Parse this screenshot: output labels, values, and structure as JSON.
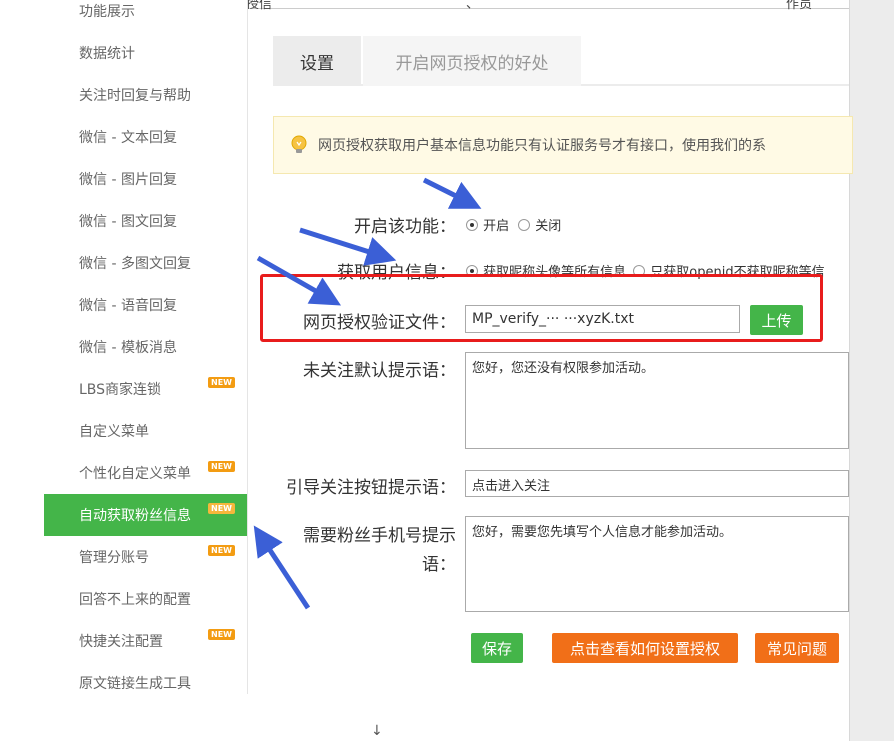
{
  "sidebar": {
    "items": [
      {
        "label": "功能展示",
        "new": false,
        "active": false
      },
      {
        "label": "数据统计",
        "new": false,
        "active": false
      },
      {
        "label": "关注时回复与帮助",
        "new": false,
        "active": false
      },
      {
        "label": "微信 - 文本回复",
        "new": false,
        "active": false
      },
      {
        "label": "微信 - 图片回复",
        "new": false,
        "active": false
      },
      {
        "label": "微信 - 图文回复",
        "new": false,
        "active": false
      },
      {
        "label": "微信 - 多图文回复",
        "new": false,
        "active": false
      },
      {
        "label": "微信 - 语音回复",
        "new": false,
        "active": false
      },
      {
        "label": "微信 - 模板消息",
        "new": false,
        "active": false
      },
      {
        "label": "LBS商家连锁",
        "new": true,
        "active": false
      },
      {
        "label": "自定义菜单",
        "new": false,
        "active": false
      },
      {
        "label": "个性化自定义菜单",
        "new": true,
        "active": false
      },
      {
        "label": "自动获取粉丝信息",
        "new": true,
        "active": true
      },
      {
        "label": "管理分账号",
        "new": true,
        "active": false
      },
      {
        "label": "回答不上来的配置",
        "new": false,
        "active": false
      },
      {
        "label": "快捷关注配置",
        "new": true,
        "active": false
      },
      {
        "label": "原文链接生成工具",
        "new": false,
        "active": false
      }
    ],
    "new_badge": "NEW",
    "active_color": "#44b549"
  },
  "tabs": [
    {
      "label": "设置",
      "active": true
    },
    {
      "label": "开启网页授权的好处",
      "active": false
    }
  ],
  "notice": {
    "text": "网页授权获取用户基本信息功能只有认证服务号才有接口，使用我们的系",
    "icon": "lightbulb-icon"
  },
  "form": {
    "enable": {
      "label": "开启该功能：",
      "options": [
        "开启",
        "关闭"
      ],
      "selected": "开启"
    },
    "userinfo": {
      "label": "获取用户信息：",
      "options": [
        "获取昵称头像等所有信息",
        "只获取openid不获取昵称等信"
      ],
      "selected": "获取昵称头像等所有信息"
    },
    "verify_file": {
      "label": "网页授权验证文件：",
      "value": "MP_verify_··· ···xyzK.txt",
      "upload_label": "上传"
    },
    "unfollowed_tip": {
      "label": "未关注默认提示语：",
      "value": "您好，您还没有权限参加活动。"
    },
    "follow_button_tip": {
      "label": "引导关注按钮提示语：",
      "value": "点击进入关注"
    },
    "phone_tip": {
      "label_line1": "需要粉丝手机号提示",
      "label_line2": "语：",
      "value": "您好，需要您先填写个人信息才能参加活动。"
    }
  },
  "actions": {
    "save": "保存",
    "how_to": "点击查看如何设置授权",
    "faq": "常见问题"
  },
  "top_scraps": [
    "授信",
    "、",
    "作员"
  ],
  "colors": {
    "green": "#44b549",
    "orange": "#f16f18",
    "red_highlight": "#e81c1c",
    "arrow_blue": "#3b5fd6"
  }
}
